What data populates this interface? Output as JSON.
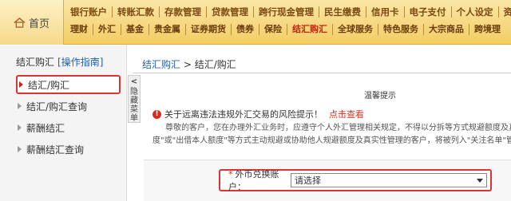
{
  "nav": {
    "home_label": "首页",
    "row1": [
      "银行账户",
      "转账汇款",
      "存款管理",
      "贷款管理",
      "跨行现金管理",
      "民生缴费",
      "信用卡",
      "电子支付",
      "个人设定",
      "资产"
    ],
    "row2": [
      "理财",
      "外汇",
      "基金",
      "贵金属",
      "证券期货",
      "债券",
      "保险",
      "结汇购汇",
      "全球服务",
      "特色服务",
      "大宗商品",
      "跨境理"
    ],
    "active_row2": "结汇购汇"
  },
  "sidebar": {
    "title": "结汇购汇",
    "guide": "[操作指南]",
    "items": [
      "结汇/购汇",
      "结汇/购汇查询",
      "薪酬结汇",
      "薪酬结汇查询"
    ],
    "collapse_label": [
      "隐",
      "藏",
      "菜",
      "单"
    ]
  },
  "breadcrumb": {
    "root": "结汇购汇",
    "sep": ">",
    "current": "结汇/购汇"
  },
  "notice": {
    "title": "温馨提示",
    "warning": "关于远离违法违规外汇交易的风险提示！",
    "warning_link": "点击查看",
    "line1": "尊敬的客户，您在办理外汇业务时，应遵守个人外汇管理相关规定，不得以分拆等方式规避额度及真实性管理",
    "line2": "度\"或\"出借本人额度\"等方式主动规避或协助他人规避额度及真实性管理的客户，将被列入\"关注名单\"管理，影响外"
  },
  "form": {
    "label": "外币兑换账户：",
    "required_mark": "*",
    "select_value": "请选择"
  },
  "colors": {
    "nav_bg": "#f3cd64",
    "accent_red": "#d33",
    "link_blue": "#2a5fa5"
  }
}
